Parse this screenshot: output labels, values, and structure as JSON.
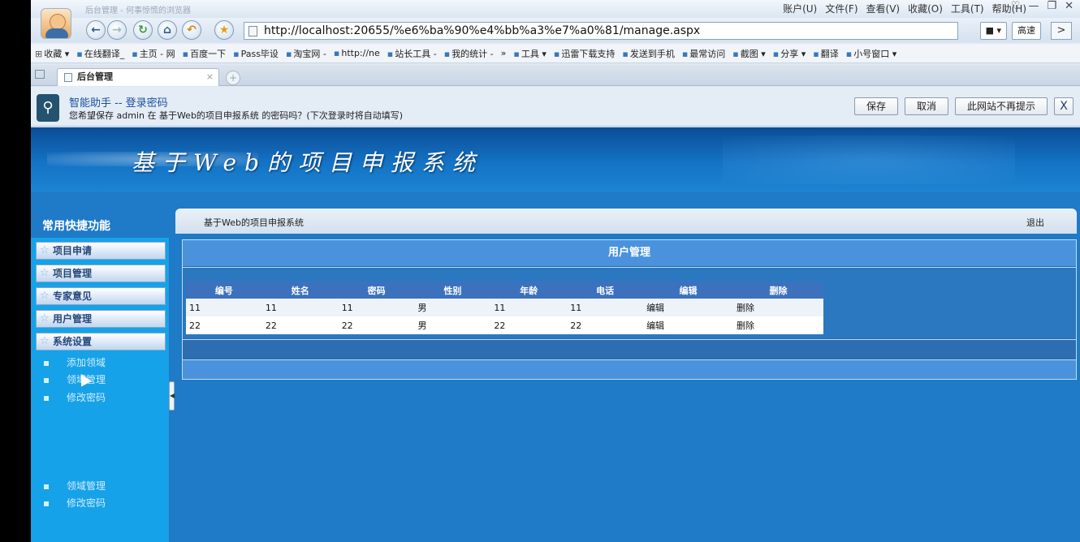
{
  "window": {
    "title": "后台管理 - 何事惊慌的浏览器",
    "menus": [
      "账户(U)",
      "文件(F)",
      "查看(V)",
      "收藏(O)",
      "工具(T)",
      "帮助(H)"
    ]
  },
  "navbar": {
    "url": "http://localhost:20655/%e6%ba%90%e4%bb%a3%e7%a0%81/manage.aspx",
    "speed_label": "高速"
  },
  "favorites": [
    "收藏 ▾",
    "在线翻译_",
    "主页 - 网",
    "百度一下",
    "Pass毕设",
    "淘宝网 -",
    "http://ne",
    "站长工具 -",
    "我的统计 -",
    "»",
    "工具 ▾",
    "迅雷下载支持",
    "发送到手机",
    "最常访问",
    "截图 ▾",
    "分享 ▾",
    "翻译",
    "小号窗口 ▾"
  ],
  "tab": {
    "label": "后台管理",
    "close": "×",
    "new": "+"
  },
  "password_bar": {
    "title": "智能助手 -- 登录密码",
    "message": "您希望保存 admin 在 基于Web的项目申报系统 的密码吗？(下次登录时将自动填写)",
    "buttons": {
      "save": "保存",
      "cancel": "取消",
      "never": "此网站不再提示",
      "close": "X"
    }
  },
  "site": {
    "title": "基于Web的项目申报系统"
  },
  "sidebar": {
    "heading": "常用快捷功能",
    "menus": [
      "项目申请",
      "项目管理",
      "专家意见",
      "用户管理",
      "系统设置"
    ],
    "sub_links_top": [
      "添加领域",
      "领域管理",
      "修改密码"
    ],
    "sub_links_bottom": [
      "领域管理",
      "修改密码"
    ]
  },
  "content": {
    "breadcrumb": "基于Web的项目申报系统",
    "logout": "退出",
    "panel_title": "用户管理",
    "table": {
      "headers": [
        "编号",
        "姓名",
        "密码",
        "性别",
        "年龄",
        "电话",
        "编辑",
        "删除"
      ],
      "rows": [
        [
          "11",
          "11",
          "11",
          "男",
          "11",
          "11",
          "编辑",
          "删除"
        ],
        [
          "22",
          "22",
          "22",
          "男",
          "22",
          "22",
          "编辑",
          "删除"
        ]
      ]
    }
  }
}
